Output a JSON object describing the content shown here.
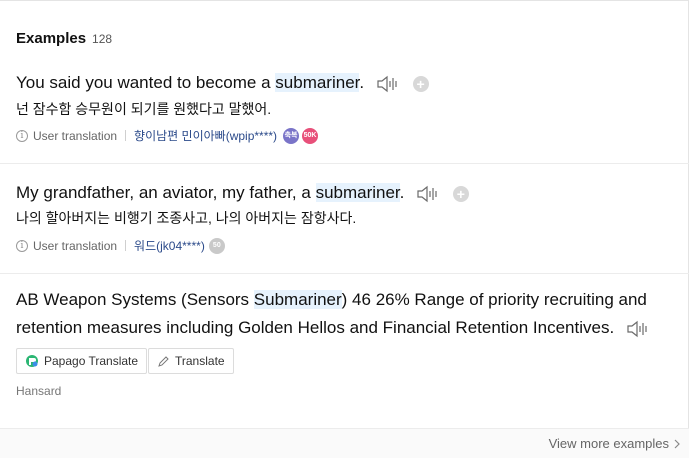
{
  "header": {
    "title": "Examples",
    "count": "128"
  },
  "examples": [
    {
      "en_before": "You said you wanted to become a ",
      "en_highlight": "submariner",
      "en_after": ".",
      "ko": "넌 잠수함 승무원이 되기를 원했다고 말했어.",
      "meta_label": "User translation",
      "user": "향이남편 민이아빠(wpip****)",
      "badges": [
        "축복",
        "50K"
      ]
    },
    {
      "en_before": "My grandfather, an aviator, my father, a ",
      "en_highlight": "submariner",
      "en_after": ".",
      "ko": "나의 할아버지는 비행기 조종사고, 나의 아버지는 잠항사다.",
      "meta_label": "User translation",
      "user": "워드(jk04****)",
      "badges": [
        "50"
      ]
    },
    {
      "text_before": "AB Weapon Systems (Sensors ",
      "text_highlight": "Submariner",
      "text_after": ") 46 26% Range of priority recruiting and retention measures including Golden Hellos and Financial Retention Incentives.",
      "papago_label": "Papago Translate",
      "translate_label": "Translate",
      "source": "Hansard"
    }
  ],
  "footer": {
    "more_label": "View more examples"
  },
  "icons": {
    "speaker": "speaker-icon",
    "add": "add-icon",
    "info": "info-icon",
    "pen": "pen-icon",
    "papago": "papago-icon",
    "chevron": "chevron-right-icon"
  },
  "colors": {
    "highlight": "#e6f2fd",
    "user_link": "#2b4a8a",
    "badge_purple": "#7a74c8",
    "badge_pink": "#e8507a"
  }
}
